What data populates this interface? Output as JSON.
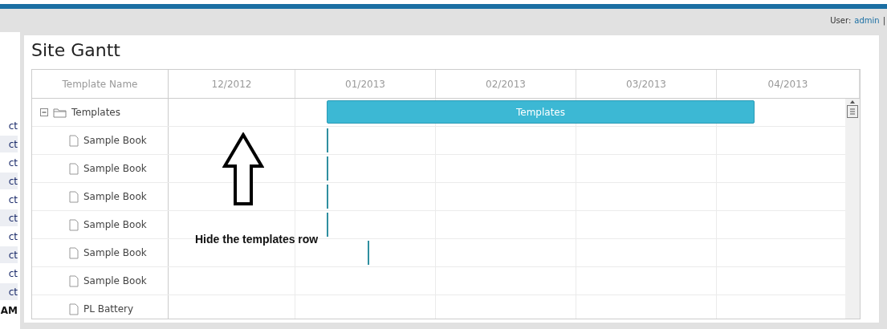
{
  "header": {
    "user_label": "User:",
    "user_name": "admin",
    "separator": "|"
  },
  "sidebar": {
    "items": [
      {
        "label": "ct"
      },
      {
        "label": "ct"
      },
      {
        "label": "ct"
      },
      {
        "label": "ct"
      },
      {
        "label": "ct"
      },
      {
        "label": "ct"
      },
      {
        "label": "ct"
      },
      {
        "label": "ct"
      },
      {
        "label": "ct"
      },
      {
        "label": "ct"
      },
      {
        "label": "AM",
        "bold": true
      }
    ]
  },
  "title": "Site Gantt",
  "gantt": {
    "name_column": "Template Name",
    "months": [
      "12/2012",
      "01/2013",
      "02/2013",
      "03/2013",
      "04/2013"
    ],
    "rows": [
      {
        "name": "Templates",
        "kind": "folder",
        "expanded": true,
        "bar": {
          "kind": "summary",
          "label": "Templates"
        }
      },
      {
        "name": "Sample Book",
        "kind": "file",
        "bar": {
          "kind": "milestone"
        }
      },
      {
        "name": "Sample Book",
        "kind": "file",
        "bar": {
          "kind": "milestone"
        }
      },
      {
        "name": "Sample Book",
        "kind": "file",
        "bar": {
          "kind": "milestone"
        }
      },
      {
        "name": "Sample Book",
        "kind": "file",
        "bar": {
          "kind": "milestone"
        }
      },
      {
        "name": "Sample Book",
        "kind": "file",
        "bar": {
          "kind": "milestone"
        }
      },
      {
        "name": "Sample Book",
        "kind": "file"
      },
      {
        "name": "PL Battery",
        "kind": "file"
      }
    ]
  },
  "annotation": {
    "text": "Hide the templates row"
  }
}
